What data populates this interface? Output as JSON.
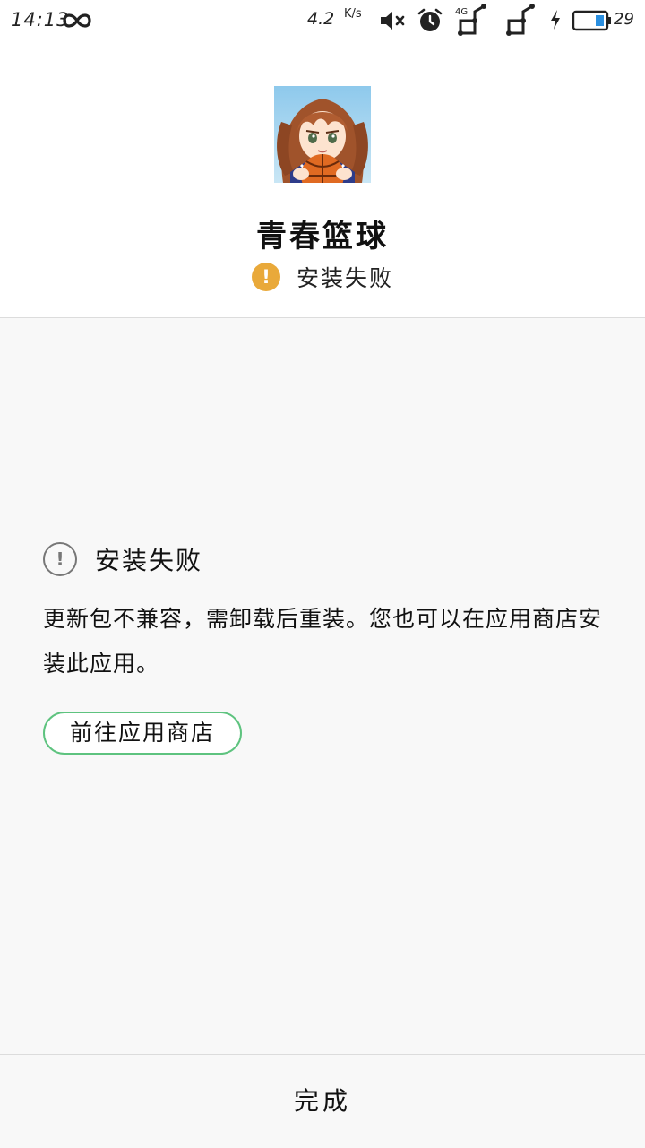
{
  "status_bar": {
    "time": "14:13",
    "infinity_icon": "infinity-icon",
    "net_speed": "4.2",
    "net_unit": "K/s",
    "network_type": "4G",
    "battery_percent": "29",
    "icons": [
      "infinity-icon",
      "mute-icon",
      "alarm-icon",
      "signal-icon",
      "signal-icon",
      "charging-icon",
      "battery-icon"
    ]
  },
  "app": {
    "name": "青春篮球",
    "status": "安装失败"
  },
  "message": {
    "title": "安装失败",
    "body": "更新包不兼容，需卸载后重装。您也可以在应用商店安装此应用。",
    "store_button": "前往应用商店"
  },
  "footer": {
    "done_button": "完成"
  },
  "colors": {
    "warning": "#e9a93a",
    "button_border": "#5ec37f",
    "background": "#f8f8f8"
  }
}
